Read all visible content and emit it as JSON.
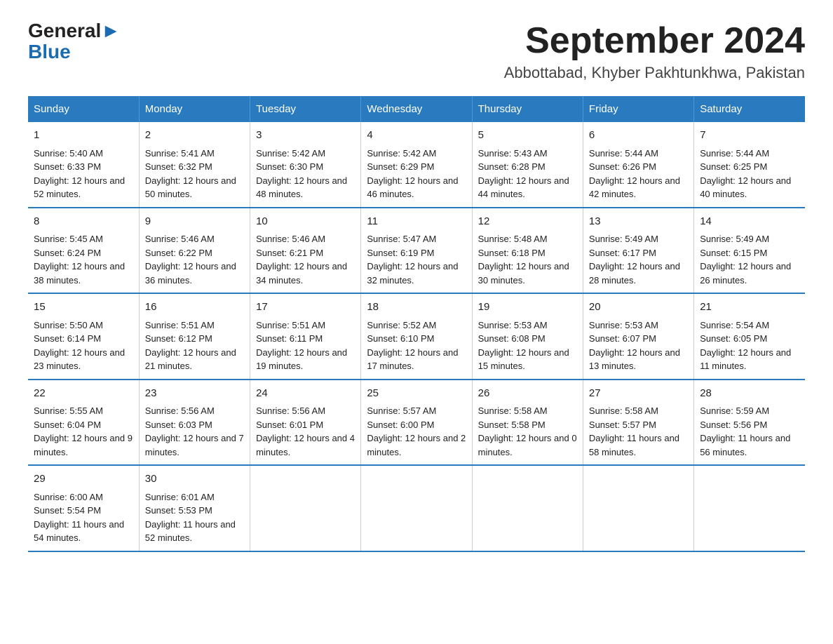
{
  "logo": {
    "part1": "General",
    "part2": "Blue"
  },
  "title": "September 2024",
  "subtitle": "Abbottabad, Khyber Pakhtunkhwa, Pakistan",
  "days_of_week": [
    "Sunday",
    "Monday",
    "Tuesday",
    "Wednesday",
    "Thursday",
    "Friday",
    "Saturday"
  ],
  "weeks": [
    [
      {
        "day": "1",
        "sunrise": "5:40 AM",
        "sunset": "6:33 PM",
        "daylight": "12 hours and 52 minutes."
      },
      {
        "day": "2",
        "sunrise": "5:41 AM",
        "sunset": "6:32 PM",
        "daylight": "12 hours and 50 minutes."
      },
      {
        "day": "3",
        "sunrise": "5:42 AM",
        "sunset": "6:30 PM",
        "daylight": "12 hours and 48 minutes."
      },
      {
        "day": "4",
        "sunrise": "5:42 AM",
        "sunset": "6:29 PM",
        "daylight": "12 hours and 46 minutes."
      },
      {
        "day": "5",
        "sunrise": "5:43 AM",
        "sunset": "6:28 PM",
        "daylight": "12 hours and 44 minutes."
      },
      {
        "day": "6",
        "sunrise": "5:44 AM",
        "sunset": "6:26 PM",
        "daylight": "12 hours and 42 minutes."
      },
      {
        "day": "7",
        "sunrise": "5:44 AM",
        "sunset": "6:25 PM",
        "daylight": "12 hours and 40 minutes."
      }
    ],
    [
      {
        "day": "8",
        "sunrise": "5:45 AM",
        "sunset": "6:24 PM",
        "daylight": "12 hours and 38 minutes."
      },
      {
        "day": "9",
        "sunrise": "5:46 AM",
        "sunset": "6:22 PM",
        "daylight": "12 hours and 36 minutes."
      },
      {
        "day": "10",
        "sunrise": "5:46 AM",
        "sunset": "6:21 PM",
        "daylight": "12 hours and 34 minutes."
      },
      {
        "day": "11",
        "sunrise": "5:47 AM",
        "sunset": "6:19 PM",
        "daylight": "12 hours and 32 minutes."
      },
      {
        "day": "12",
        "sunrise": "5:48 AM",
        "sunset": "6:18 PM",
        "daylight": "12 hours and 30 minutes."
      },
      {
        "day": "13",
        "sunrise": "5:49 AM",
        "sunset": "6:17 PM",
        "daylight": "12 hours and 28 minutes."
      },
      {
        "day": "14",
        "sunrise": "5:49 AM",
        "sunset": "6:15 PM",
        "daylight": "12 hours and 26 minutes."
      }
    ],
    [
      {
        "day": "15",
        "sunrise": "5:50 AM",
        "sunset": "6:14 PM",
        "daylight": "12 hours and 23 minutes."
      },
      {
        "day": "16",
        "sunrise": "5:51 AM",
        "sunset": "6:12 PM",
        "daylight": "12 hours and 21 minutes."
      },
      {
        "day": "17",
        "sunrise": "5:51 AM",
        "sunset": "6:11 PM",
        "daylight": "12 hours and 19 minutes."
      },
      {
        "day": "18",
        "sunrise": "5:52 AM",
        "sunset": "6:10 PM",
        "daylight": "12 hours and 17 minutes."
      },
      {
        "day": "19",
        "sunrise": "5:53 AM",
        "sunset": "6:08 PM",
        "daylight": "12 hours and 15 minutes."
      },
      {
        "day": "20",
        "sunrise": "5:53 AM",
        "sunset": "6:07 PM",
        "daylight": "12 hours and 13 minutes."
      },
      {
        "day": "21",
        "sunrise": "5:54 AM",
        "sunset": "6:05 PM",
        "daylight": "12 hours and 11 minutes."
      }
    ],
    [
      {
        "day": "22",
        "sunrise": "5:55 AM",
        "sunset": "6:04 PM",
        "daylight": "12 hours and 9 minutes."
      },
      {
        "day": "23",
        "sunrise": "5:56 AM",
        "sunset": "6:03 PM",
        "daylight": "12 hours and 7 minutes."
      },
      {
        "day": "24",
        "sunrise": "5:56 AM",
        "sunset": "6:01 PM",
        "daylight": "12 hours and 4 minutes."
      },
      {
        "day": "25",
        "sunrise": "5:57 AM",
        "sunset": "6:00 PM",
        "daylight": "12 hours and 2 minutes."
      },
      {
        "day": "26",
        "sunrise": "5:58 AM",
        "sunset": "5:58 PM",
        "daylight": "12 hours and 0 minutes."
      },
      {
        "day": "27",
        "sunrise": "5:58 AM",
        "sunset": "5:57 PM",
        "daylight": "11 hours and 58 minutes."
      },
      {
        "day": "28",
        "sunrise": "5:59 AM",
        "sunset": "5:56 PM",
        "daylight": "11 hours and 56 minutes."
      }
    ],
    [
      {
        "day": "29",
        "sunrise": "6:00 AM",
        "sunset": "5:54 PM",
        "daylight": "11 hours and 54 minutes."
      },
      {
        "day": "30",
        "sunrise": "6:01 AM",
        "sunset": "5:53 PM",
        "daylight": "11 hours and 52 minutes."
      },
      null,
      null,
      null,
      null,
      null
    ]
  ],
  "labels": {
    "sunrise_prefix": "Sunrise: ",
    "sunset_prefix": "Sunset: ",
    "daylight_prefix": "Daylight: "
  }
}
